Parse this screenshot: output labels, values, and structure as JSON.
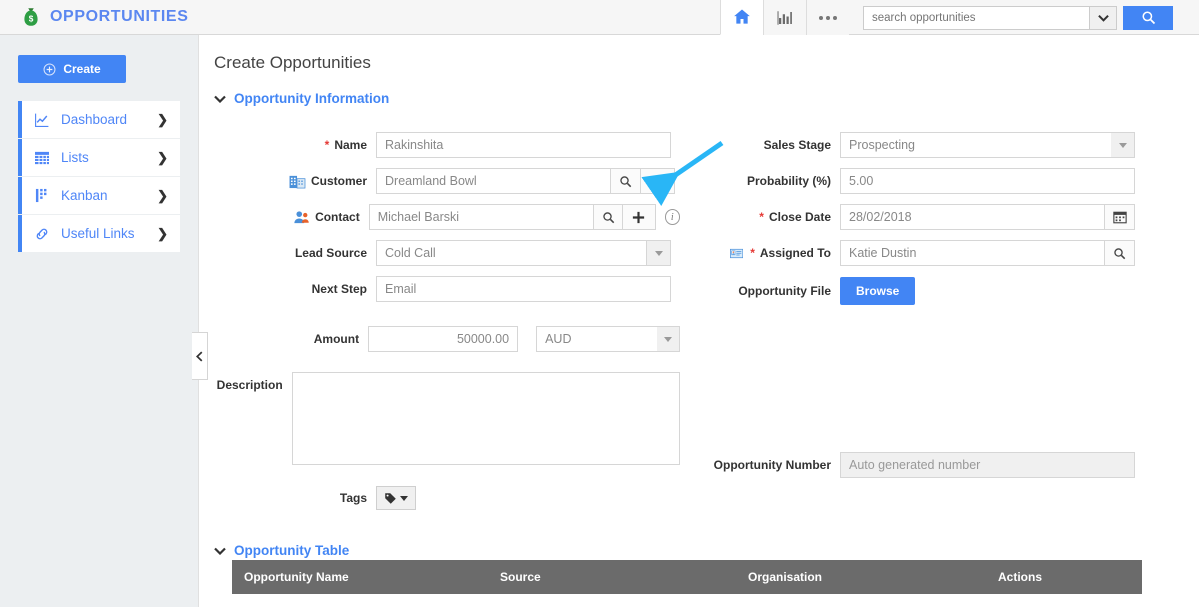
{
  "app": {
    "brand_title": "OPPORTUNITIES",
    "brand_icon": "money-bag-icon"
  },
  "header": {
    "home_icon": "home-icon",
    "chart_icon": "bar-chart-icon",
    "more_icon": "more-dots-icon",
    "search": {
      "placeholder": "search opportunities",
      "value": "",
      "dropdown_icon": "chevron-down-icon",
      "button_icon": "search-icon"
    }
  },
  "sidebar": {
    "create_label": "Create",
    "create_icon": "plus-circle-icon",
    "collapse_icon": "chevron-left-icon",
    "items": [
      {
        "label": "Dashboard",
        "icon": "line-chart-icon",
        "chevron": "❯"
      },
      {
        "label": "Lists",
        "icon": "grid-icon",
        "chevron": "❯"
      },
      {
        "label": "Kanban",
        "icon": "kanban-icon",
        "chevron": "❯"
      },
      {
        "label": "Useful Links",
        "icon": "link-icon",
        "chevron": "❯"
      }
    ]
  },
  "main": {
    "page_title": "Create Opportunities",
    "sections": {
      "opportunity_information": {
        "title": "Opportunity Information",
        "chevron": "⌄"
      },
      "opportunity_table": {
        "title": "Opportunity Table",
        "chevron": "⌄"
      }
    },
    "fields": {
      "name": {
        "label": "Name",
        "required": true,
        "value": "Rakinshita"
      },
      "customer": {
        "label": "Customer",
        "icon": "building-icon",
        "required": false,
        "value": "Dreamland Bowl",
        "search_icon": "search-icon",
        "add_icon": "plus-icon"
      },
      "contact": {
        "label": "Contact",
        "icon": "person-icon",
        "required": false,
        "value": "Michael Barski",
        "search_icon": "search-icon",
        "add_icon": "plus-icon",
        "info_icon": "info-circle-icon"
      },
      "lead_source": {
        "label": "Lead Source",
        "value": "Cold Call",
        "dropdown_icon": "caret-down-icon"
      },
      "next_step": {
        "label": "Next Step",
        "value": "Email"
      },
      "amount": {
        "label": "Amount",
        "value": "50000.00",
        "currency": "AUD",
        "dropdown_icon": "caret-down-icon"
      },
      "description": {
        "label": "Description",
        "value": ""
      },
      "tags": {
        "label": "Tags",
        "icon": "tag-icon",
        "dropdown_icon": "caret-down-icon"
      },
      "sales_stage": {
        "label": "Sales Stage",
        "value": "Prospecting",
        "dropdown_icon": "caret-down-icon"
      },
      "probability": {
        "label": "Probability (%)",
        "value": "5.00"
      },
      "close_date": {
        "label": "Close Date",
        "required": true,
        "value": "28/02/2018",
        "icon": "calendar-icon"
      },
      "assigned_to": {
        "label": "Assigned To",
        "required": true,
        "icon": "id-card-icon",
        "value": "Katie Dustin",
        "search_icon": "search-icon"
      },
      "opportunity_file": {
        "label": "Opportunity File",
        "button_label": "Browse"
      },
      "opportunity_number": {
        "label": "Opportunity Number",
        "value": "Auto generated number",
        "disabled": true
      }
    },
    "table": {
      "columns": [
        "Opportunity Name",
        "Source",
        "Organisation",
        "Actions"
      ],
      "rows": []
    }
  },
  "annotation": {
    "arrow_color": "#29b6f6",
    "target": "customer-add-button"
  },
  "colors": {
    "accent_blue": "#4285f4",
    "link_blue": "#4f86f7",
    "required_red": "#e53935",
    "sidebar_bg": "#eceff1",
    "table_header_bg": "#6b6b6b",
    "annotation_cyan": "#29b6f6"
  }
}
